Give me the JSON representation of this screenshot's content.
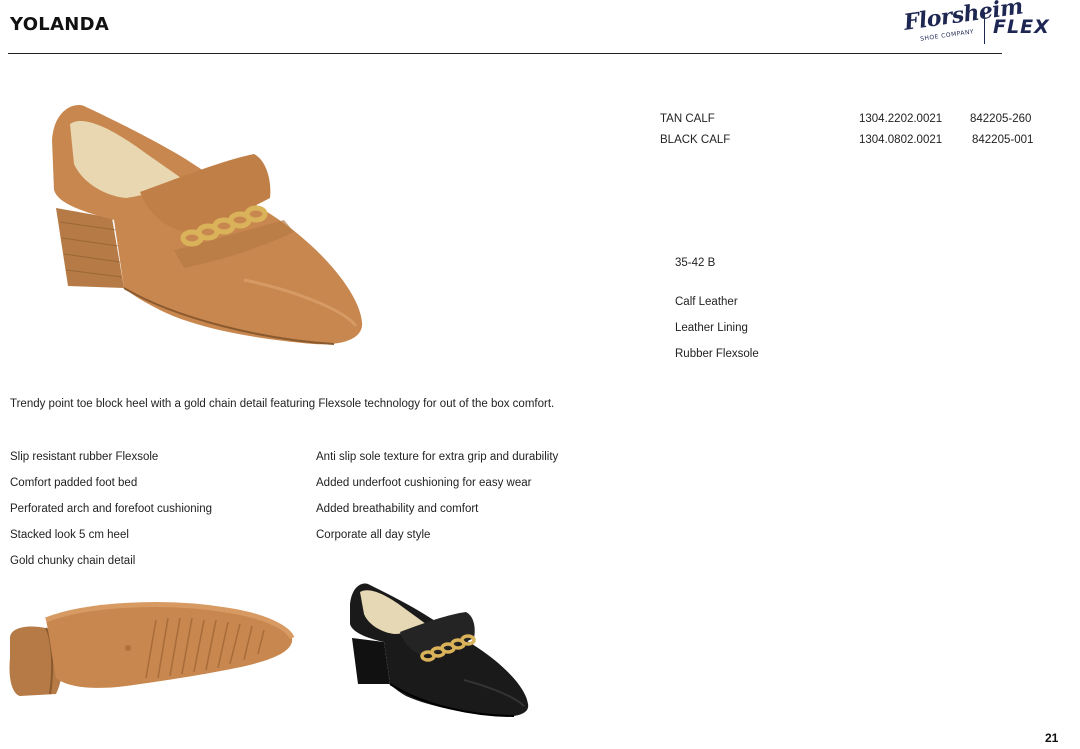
{
  "header": {
    "title": "YOLANDA",
    "brand_script": "Florsheim",
    "brand_subtitle": "SHOE COMPANY",
    "brand_line": "FLEX"
  },
  "skus": [
    {
      "color": "TAN CALF",
      "code": "1304.2202.0021",
      "upc": "842205-260"
    },
    {
      "color": "BLACK CALF",
      "code": "1304.0802.0021",
      "upc": "842205-001"
    }
  ],
  "specs": {
    "size_range": "35-42 B",
    "materials": [
      "Calf Leather",
      "Leather Lining",
      "Rubber Flexsole"
    ]
  },
  "description": "Trendy point toe block heel with a gold chain detail featuring Flexsole technology for out of the box comfort.",
  "features_left": [
    "Slip resistant rubber Flexsole",
    "Comfort padded foot bed",
    "Perforated arch and forefoot cushioning",
    "Stacked look 5 cm heel",
    "Gold chunky chain detail"
  ],
  "features_right": [
    "Anti slip sole texture for extra grip and durability",
    "Added underfoot cushioning for easy wear",
    "Added breathability and comfort",
    "Corporate all day style"
  ],
  "images": {
    "main": "tan-calf-loafer-side-view",
    "sole": "tan-calf-loafer-sole-view",
    "black": "black-calf-loafer-side-view"
  },
  "colors": {
    "tan": "#c8874f",
    "tan_dark": "#9c6433",
    "black": "#1a1a1a",
    "gold": "#d9b25a",
    "brand_navy": "#1e2652"
  },
  "page_number": "21"
}
